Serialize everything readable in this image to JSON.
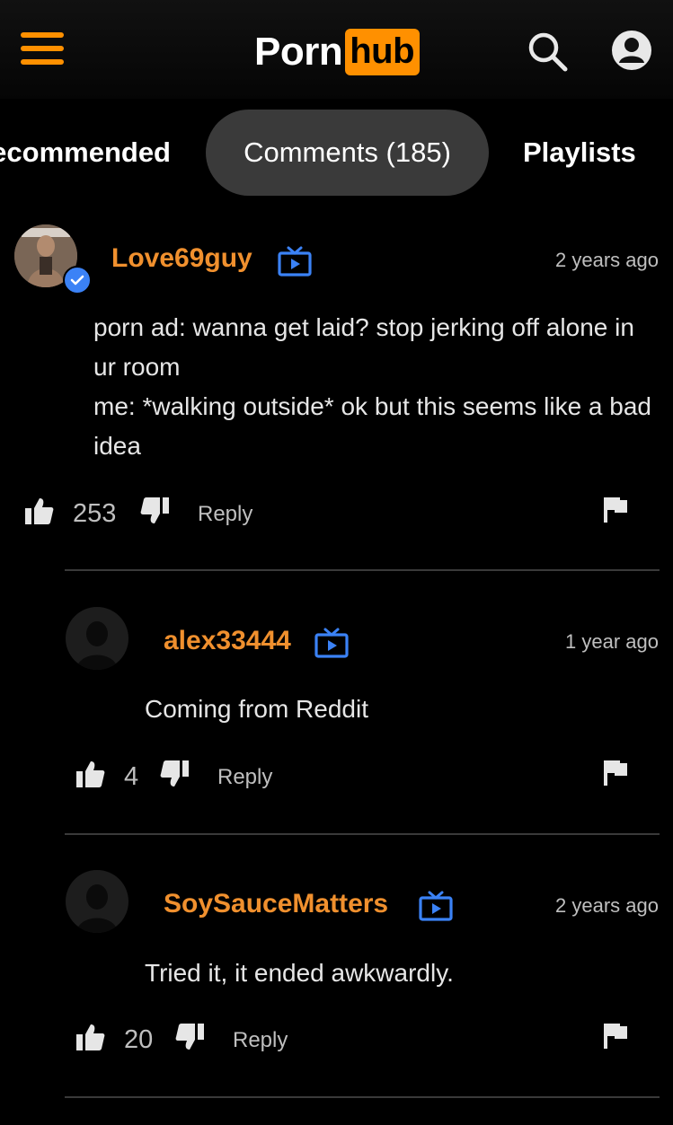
{
  "header": {
    "logo_left": "Porn",
    "logo_right": "hub",
    "menu_icon": "hamburger-menu-icon",
    "search_icon": "search-icon",
    "user_icon": "user-account-icon",
    "accent_color": "#ff9000"
  },
  "tabs": [
    {
      "label": "Recommended",
      "visible_label": "ecommended",
      "active": false
    },
    {
      "label": "Comments (185)",
      "active": true
    },
    {
      "label": "Playlists",
      "active": false
    }
  ],
  "comments": [
    {
      "username": "Love69guy",
      "verified": true,
      "time": "2 years ago",
      "text": "porn ad: wanna get laid? stop jerking off alone in ur room\nme: *walking outside* ok but this seems like a bad idea",
      "likes": "253",
      "reply_label": "Reply"
    },
    {
      "username": "alex33444",
      "verified": false,
      "time": "1 year ago",
      "text": "Coming from Reddit",
      "likes": "4",
      "reply_label": "Reply"
    },
    {
      "username": "SoySauceMatters",
      "verified": false,
      "time": "2 years ago",
      "text": "Tried it, it ended awkwardly.",
      "likes": "20",
      "reply_label": "Reply"
    }
  ],
  "colors": {
    "username": "#f0902e",
    "channel_icon": "#3b82f6",
    "background": "#000000"
  }
}
